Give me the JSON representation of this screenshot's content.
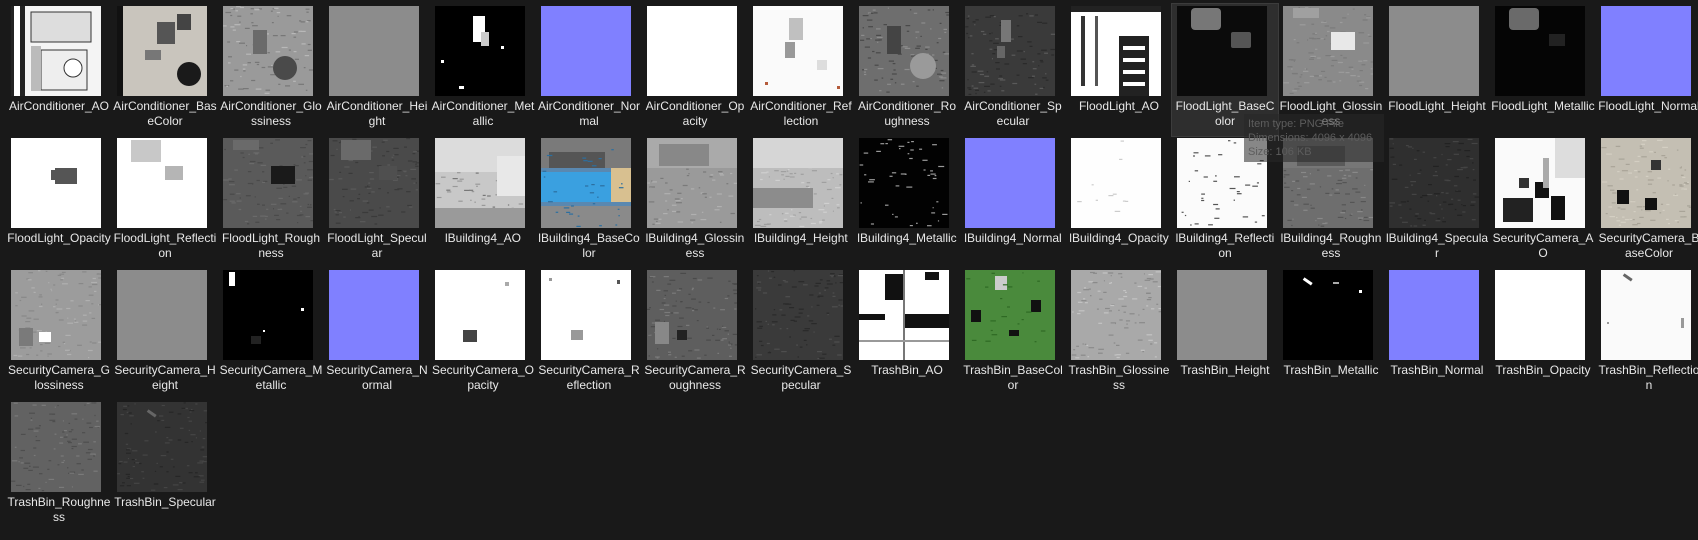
{
  "items": [
    {
      "name": "AirConditioner_AO",
      "thumb": "ac-ao"
    },
    {
      "name": "AirConditioner_BaseColor",
      "thumb": "ac-base"
    },
    {
      "name": "AirConditioner_Glossiness",
      "thumb": "ac-gloss"
    },
    {
      "name": "AirConditioner_Height",
      "thumb": "flat-gray"
    },
    {
      "name": "AirConditioner_Metallic",
      "thumb": "ac-metal"
    },
    {
      "name": "AirConditioner_Normal",
      "thumb": "normal"
    },
    {
      "name": "AirConditioner_Opacity",
      "thumb": "white"
    },
    {
      "name": "AirConditioner_Reflection",
      "thumb": "ac-refl"
    },
    {
      "name": "AirConditioner_Roughness",
      "thumb": "ac-rough"
    },
    {
      "name": "AirConditioner_Specular",
      "thumb": "ac-spec"
    },
    {
      "name": "FloodLight_AO",
      "thumb": "fl-ao"
    },
    {
      "name": "FloodLight_BaseColor",
      "thumb": "fl-base"
    },
    {
      "name": "FloodLight_Glossiness",
      "thumb": "fl-gloss"
    },
    {
      "name": "FloodLight_Height",
      "thumb": "flat-gray"
    },
    {
      "name": "FloodLight_Metallic",
      "thumb": "fl-metal"
    },
    {
      "name": "FloodLight_Normal",
      "thumb": "normal"
    },
    {
      "name": "FloodLight_Opacity",
      "thumb": "fl-opacity"
    },
    {
      "name": "FloodLight_Reflection",
      "thumb": "fl-refl"
    },
    {
      "name": "FloodLight_Roughness",
      "thumb": "fl-rough"
    },
    {
      "name": "FloodLight_Specular",
      "thumb": "fl-spec"
    },
    {
      "name": "lBuilding4_AO",
      "thumb": "bld-ao"
    },
    {
      "name": "lBuilding4_BaseColor",
      "thumb": "bld-base"
    },
    {
      "name": "lBuilding4_Glossiness",
      "thumb": "bld-gloss"
    },
    {
      "name": "lBuilding4_Height",
      "thumb": "bld-height"
    },
    {
      "name": "lBuilding4_Metallic",
      "thumb": "bld-metal"
    },
    {
      "name": "lBuilding4_Normal",
      "thumb": "normal"
    },
    {
      "name": "lBuilding4_Opacity",
      "thumb": "bld-opacity"
    },
    {
      "name": "lBuilding4_Reflection",
      "thumb": "bld-refl"
    },
    {
      "name": "lBuilding4_Roughness",
      "thumb": "bld-rough"
    },
    {
      "name": "lBuilding4_Specular",
      "thumb": "bld-spec"
    },
    {
      "name": "SecurityCamera_AO",
      "thumb": "sc-ao"
    },
    {
      "name": "SecurityCamera_BaseColor",
      "thumb": "sc-base"
    },
    {
      "name": "SecurityCamera_Glossiness",
      "thumb": "sc-gloss"
    },
    {
      "name": "SecurityCamera_Height",
      "thumb": "flat-gray"
    },
    {
      "name": "SecurityCamera_Metallic",
      "thumb": "sc-metal"
    },
    {
      "name": "SecurityCamera_Normal",
      "thumb": "normal"
    },
    {
      "name": "SecurityCamera_Opacity",
      "thumb": "sc-opacity"
    },
    {
      "name": "SecurityCamera_Reflection",
      "thumb": "sc-refl"
    },
    {
      "name": "SecurityCamera_Roughness",
      "thumb": "sc-rough"
    },
    {
      "name": "SecurityCamera_Specular",
      "thumb": "sc-spec"
    },
    {
      "name": "TrashBin_AO",
      "thumb": "tb-ao"
    },
    {
      "name": "TrashBin_BaseColor",
      "thumb": "tb-base"
    },
    {
      "name": "TrashBin_Glossiness",
      "thumb": "tb-gloss"
    },
    {
      "name": "TrashBin_Height",
      "thumb": "flat-gray"
    },
    {
      "name": "TrashBin_Metallic",
      "thumb": "tb-metal"
    },
    {
      "name": "TrashBin_Normal",
      "thumb": "normal"
    },
    {
      "name": "TrashBin_Opacity",
      "thumb": "white"
    },
    {
      "name": "TrashBin_Reflection",
      "thumb": "tb-refl"
    },
    {
      "name": "TrashBin_Roughness",
      "thumb": "tb-rough"
    },
    {
      "name": "TrashBin_Specular",
      "thumb": "tb-spec"
    }
  ],
  "hovered_item": "FloodLight_BaseColor",
  "tooltip": {
    "type_line": "Item type: PNG File",
    "dimensions_line": "Dimensions: 4096 x 4096",
    "size_line": "Size: 106 KB"
  },
  "colors": {
    "background": "#191919",
    "text": "#e8e8e8",
    "hover": "#2e2e2e",
    "normal_map": "#8080ff",
    "trashbin_green": "#4a8a3c"
  }
}
